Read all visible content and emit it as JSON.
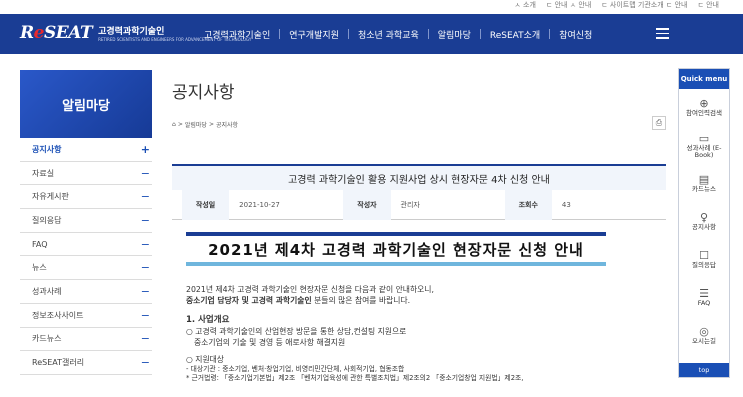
{
  "topbar": {
    "links": [
      "ㅅ 소개",
      "ㄷ 안내 ㅅ 안내",
      "ㄷ 사이트맵 기관소개 ㄷ 안내",
      "ㄷ 안내"
    ]
  },
  "header": {
    "logo_mark": "ReSEAT",
    "logo_ko": "고경력과학기술인",
    "logo_en": "RETIRED SCIENTISTS AND ENGINEERS FOR ADVANCEMENT OF TECHNOLOGY",
    "menu": [
      "고경력과학기술인",
      "연구개발지원",
      "청소년 과학교육",
      "알림마당",
      "ReSEAT소개",
      "참여신청"
    ]
  },
  "sidebar": {
    "title": "알림마당",
    "items": [
      {
        "label": "공지사항",
        "sign": "+"
      },
      {
        "label": "자료실",
        "sign": "−"
      },
      {
        "label": "자유게시판",
        "sign": "−"
      },
      {
        "label": "질의응답",
        "sign": "−"
      },
      {
        "label": "FAQ",
        "sign": "−"
      },
      {
        "label": "뉴스",
        "sign": "−"
      },
      {
        "label": "성과사례",
        "sign": "−"
      },
      {
        "label": "정보조사사이트",
        "sign": "−"
      },
      {
        "label": "카드뉴스",
        "sign": "−"
      },
      {
        "label": "ReSEAT갤러리",
        "sign": "−"
      }
    ]
  },
  "main": {
    "page_title": "공지사항",
    "breadcrumb": [
      "⌂",
      ">",
      "알림마당",
      ">",
      "공지사항"
    ],
    "post_title": "고경력 과학기술인 활용 지원사업 상시 현장자문 4차 신청 안내",
    "meta": {
      "author_label": "작성일",
      "date": "2021-10-27",
      "writer_label": "작성자",
      "writer": "관리자",
      "views_label": "조회수",
      "views": "43"
    },
    "banner": "2021년 제4차 고경력 과학기술인 현장자문 신청 안내",
    "intro1": "2021년 제4차 고경력 과학기술인 현장자문 신청을 다음과 같이 안내하오니,",
    "intro2_bold": "중소기업 담당자 및 고경력 과학기술인",
    "intro2_rest": " 분들의 많은 참여를 바랍니다.",
    "section1": "1. 사업개요",
    "s1_line1": "○ 고경력 과학기술인의 산업현장 방문을 통한 상담,컨설팅 지원으로",
    "s1_line2": "중소기업의 기술 및 경영 등 애로사항 해결지원",
    "s2_title": "○ 지원대상",
    "s2_line1": "- 대상기관 : 중소기업, 벤처·창업기업, 비영리민간단체, 사회적기업, 협동조합",
    "s2_line2": "* 근거법령: 「중소기업기본법」제2조 「벤처기업육성에 관한 특별조치법」제2조의2 「중소기업창업 지원법」제2조,"
  },
  "quick": {
    "title": "Quick menu",
    "items": [
      {
        "icon": "⊕",
        "label": "참여인력검색"
      },
      {
        "icon": "▭",
        "label": "성과사례 (E-Book)"
      },
      {
        "icon": "▤",
        "label": "카드뉴스"
      },
      {
        "icon": "♀",
        "label": "공지사항"
      },
      {
        "icon": "☐",
        "label": "질의응답"
      },
      {
        "icon": "☰",
        "label": "FAQ"
      },
      {
        "icon": "◎",
        "label": "오시는길"
      }
    ],
    "top": "top"
  },
  "colors": {
    "brand_navy": "#1a3d94",
    "accent_blue": "#1a4fb5",
    "logo_red": "#e8292e",
    "banner_light": "#6fb6dd"
  }
}
